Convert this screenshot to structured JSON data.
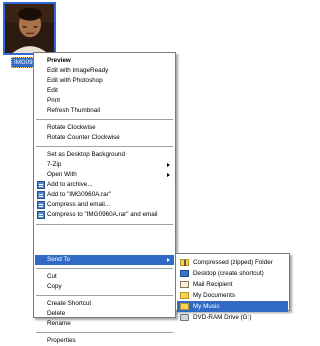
{
  "file": {
    "thumbnail_label": "IMG096"
  },
  "context_menu": {
    "items": [
      {
        "label": "Preview",
        "bold": true
      },
      {
        "label": "Edit with ImageReady"
      },
      {
        "label": "Edit with Photoshop"
      },
      {
        "label": "Edit"
      },
      {
        "label": "Print"
      },
      {
        "label": "Refresh Thumbnail"
      },
      {
        "label": "Rotate Clockwise"
      },
      {
        "label": "Rotate Counter Clockwise"
      },
      {
        "label": "Set as Desktop Background"
      },
      {
        "label": "7-Zip",
        "submenu": true
      },
      {
        "label": "Open With",
        "submenu": true
      },
      {
        "label": "Add to archive...",
        "icon": "winrar-icon"
      },
      {
        "label": "Add to \"IMG0960A.rar\"",
        "icon": "winrar-icon"
      },
      {
        "label": "Compress and email...",
        "icon": "winrar-icon"
      },
      {
        "label": "Compress to \"IMG0960A.rar\" and email",
        "icon": "winrar-icon"
      },
      {
        "label": "Send To",
        "submenu": true,
        "active": true
      },
      {
        "label": "Cut"
      },
      {
        "label": "Copy"
      },
      {
        "label": "Create Shortcut"
      },
      {
        "label": "Delete"
      },
      {
        "label": "Rename"
      },
      {
        "label": "Properties"
      }
    ]
  },
  "send_to_menu": {
    "items": [
      {
        "label": "Compressed (zipped) Folder",
        "icon": "zip-folder-icon"
      },
      {
        "label": "Desktop (create shortcut)",
        "icon": "desktop-icon"
      },
      {
        "label": "Mail Recipient",
        "icon": "mail-icon"
      },
      {
        "label": "My Documents",
        "icon": "my-documents-folder-icon"
      },
      {
        "label": "My Music",
        "icon": "my-music-folder-icon",
        "selected": true
      },
      {
        "label": "DVD-RAM Drive (G:)",
        "icon": "dvd-drive-icon"
      }
    ]
  },
  "colors": {
    "highlight": "#316ac5",
    "menu_background": "#ffffff",
    "menu_border": "#7a7a7a"
  }
}
